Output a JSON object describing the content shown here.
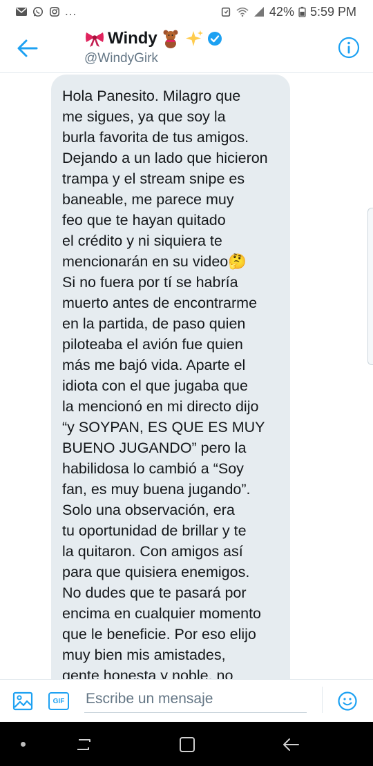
{
  "status_bar": {
    "overflow": "...",
    "battery_percent": "42%",
    "time": "5:59 PM",
    "left_icons": [
      "mail-icon",
      "whatsapp-icon",
      "instagram-icon"
    ],
    "right_icons": [
      "alarm-icon",
      "wifi-icon",
      "signal-icon",
      "battery-icon"
    ]
  },
  "header": {
    "display_name": "Windy",
    "handle": "@WindyGirk",
    "name_emojis": [
      "bow-emoji",
      "teddy-bear-emoji",
      "sparkles-emoji"
    ],
    "verified": true,
    "accent_color": "#1da1f2"
  },
  "message": {
    "lines": [
      "Hola Panesito. Milagro que",
      "me sigues, ya que soy la",
      "burla favorita de tus amigos.",
      "Dejando a un lado que hicieron",
      "trampa y el stream snipe es",
      "baneable, me parece muy",
      "feo que te hayan quitado",
      "el crédito y ni siquiera te",
      "mencionarán en su video🤔",
      "Si no fuera por tí se habría",
      "muerto antes de encontrarme",
      "en la partida, de paso quien",
      "piloteaba el avión fue quien",
      "más me bajó vida. Aparte el",
      "idiota con el que jugaba que",
      "la mencionó en mi directo dijo",
      "“y SOYPAN, ES QUE ES MUY",
      "BUENO JUGANDO” pero la",
      "habilidosa lo cambió a “Soy",
      "fan, es muy buena jugando”.",
      "Solo una observación, era",
      "tu oportunidad de brillar y te",
      "la quitaron. Con amigos así",
      "para que quisiera enemigos.",
      "No dudes que te pasará por",
      "encima en cualquier momento",
      "que le beneficie. Por eso elijo",
      "muy bien mis amistades,",
      "gente honesta y noble, no"
    ],
    "bubble_color": "#e6ecf0"
  },
  "composer": {
    "placeholder": "Escribe un mensaje",
    "gif_label": "GIF"
  }
}
